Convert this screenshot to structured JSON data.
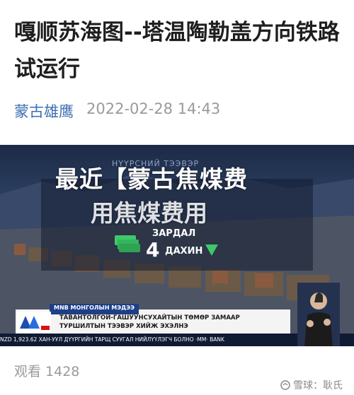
{
  "article": {
    "title": "嘎顺苏海图--塔温陶勒盖方向铁路试运行",
    "author": "蒙古雄鹰",
    "date": "2022-02-28 14:43",
    "views": "观看 1428"
  },
  "video": {
    "overlay_title": "最近【蒙古焦煤费",
    "overlay_sub": "用焦煤费用",
    "tv_header": "НҮҮРСНИЙ ТЭЭВЭР",
    "zardal": "ЗАРДАЛ",
    "factor": "4",
    "dakhin": "ДАХИН",
    "ticker_tag": "MNB МОНГОЛЫН МЭДЭЭ",
    "ticker_line1": "ТАВАНТОЛГОЙ-ГАШУУНСУХАЙТЫН ТӨМӨР ЗАМААР",
    "ticker_line2": "ТУРШИЛТЫН ТЭЭВЭР ХИЙЖ ЭХЭЛНЭ",
    "bottom_strip": "NZD 1,923.62   ХАН-УУЛ ДҮҮРГИЙН ТАРЩ СУУГАЛ НИЙЛҮҮЛЭГЧ БОЛНО   ·MM·   BANK"
  },
  "watermark": {
    "text": "雪球：耿氏"
  },
  "colors": {
    "author": "#3d6fb0",
    "muted": "#9a9a9a",
    "title": "#1e1e1e"
  }
}
